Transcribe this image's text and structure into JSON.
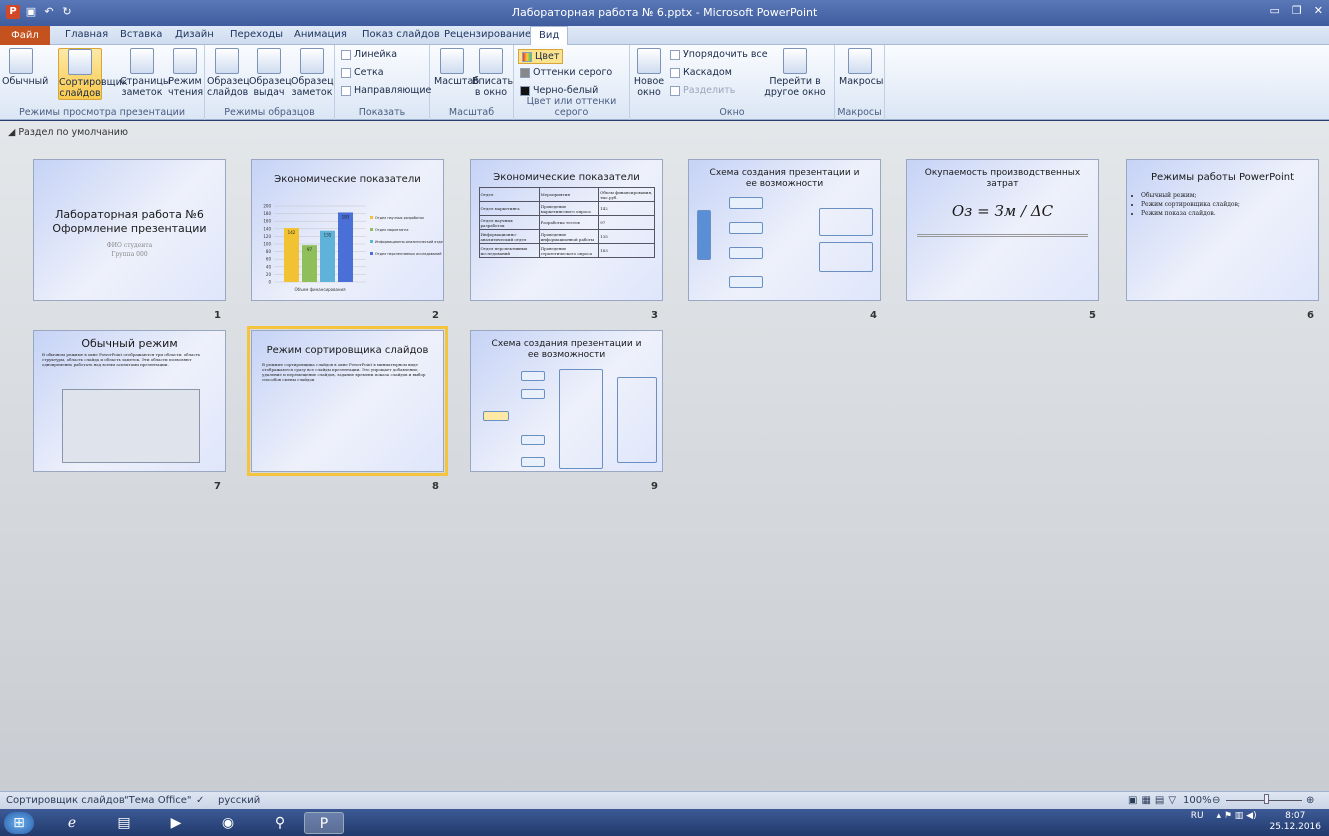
{
  "window": {
    "title": "Лабораторная работа № 6.pptx - Microsoft PowerPoint"
  },
  "tabs": [
    "Файл",
    "Главная",
    "Вставка",
    "Дизайн",
    "Переходы",
    "Анимация",
    "Показ слайдов",
    "Рецензирование",
    "Вид"
  ],
  "ribbon": {
    "groups": [
      {
        "label": "Режимы просмотра презентации",
        "buttons": [
          "Обычный",
          "Сортировщик слайдов",
          "Страницы заметок",
          "Режим чтения"
        ]
      },
      {
        "label": "Режимы образцов",
        "buttons": [
          "Образец слайдов",
          "Образец выдач",
          "Образец заметок"
        ]
      },
      {
        "label": "Показать",
        "items": [
          "Линейка",
          "Сетка",
          "Направляющие"
        ]
      },
      {
        "label": "Масштаб",
        "buttons": [
          "Масштаб",
          "Вписать в окно"
        ]
      },
      {
        "label": "Цвет или оттенки серого",
        "items": [
          "Цвет",
          "Оттенки серого",
          "Черно-белый"
        ]
      },
      {
        "label": "Окно",
        "buttons": [
          "Новое окно",
          "Перейти в другое окно"
        ],
        "items": [
          "Упорядочить все",
          "Каскадом",
          "Разделить"
        ]
      },
      {
        "label": "Макросы",
        "buttons": [
          "Макросы"
        ]
      }
    ]
  },
  "section": "Раздел по умолчанию",
  "slides": [
    {
      "n": "1",
      "title": "Лабораторная работа №6 Оформление презентации",
      "sub1": "ФИО студента",
      "sub2": "Группа 000"
    },
    {
      "n": "2",
      "title": "Экономические показатели",
      "chart_xlabel": "Объем финансирования",
      "legend": [
        "Отдел научных разработок",
        "Отдел маркетинга",
        "Информационно-аналитический отдел",
        "Отдел перспективных исследований"
      ]
    },
    {
      "n": "3",
      "title": "Экономические показатели",
      "headers": [
        "Отдел",
        "Мероприятия",
        "Объем финансирования, тыс.руб."
      ],
      "rows": [
        [
          "Отдел маркетинга",
          "Проведение маркетингового опроса",
          "142"
        ],
        [
          "Отдел научных разработок",
          "Разработка тестов",
          "97"
        ],
        [
          "Информационно-аналитический отдел",
          "Проведение информационной работы",
          "135"
        ],
        [
          "Отдел перспективных исследований",
          "Проведение стратегического опроса",
          "183"
        ]
      ]
    },
    {
      "n": "4",
      "title": "Схема создания презентации и ее возможности"
    },
    {
      "n": "5",
      "title": "Окупаемость производственных затрат",
      "formula": "Oз = Зм / ΔC"
    },
    {
      "n": "6",
      "title": "Режимы работы PowerPoint",
      "bullets": [
        "Обычный режим;",
        "Режим сортировщика слайдов;",
        "Режим показа слайдов."
      ]
    },
    {
      "n": "7",
      "title": "Обычный режим",
      "body": "В обычном режиме в окне PowerPoint отображаются три области: область структуры, область слайда и область заметок. Эти области позволяют одновременно работать над всеми аспектами презентации."
    },
    {
      "n": "8",
      "title": "Режим сортировщика слайдов",
      "body": "В режиме сортировщика слайдов в окне PowerPoint в миниатюрном виде отображаются сразу все слайды презентации. Это упрощает добавление, удаление и перемещение слайдов, задание времени показа слайдов и выбор способов смены слайдов."
    },
    {
      "n": "9",
      "title": "Схема создания презентации и ее возможности"
    }
  ],
  "chart_data": {
    "type": "bar",
    "categories": [
      "Объем финансирования"
    ],
    "series": [
      {
        "name": "Отдел научных разработок",
        "values": [
          142
        ]
      },
      {
        "name": "Отдел маркетинга",
        "values": [
          97
        ]
      },
      {
        "name": "Информационно-аналитический отдел",
        "values": [
          135
        ]
      },
      {
        "name": "Отдел перспективных исследований",
        "values": [
          183
        ]
      }
    ],
    "ylim": [
      0,
      200
    ],
    "colors": [
      "#f1c232",
      "#8fbf5a",
      "#5fb3d9",
      "#4a6fd6"
    ]
  },
  "status": {
    "view": "Сортировщик слайдов",
    "theme": "\"Тема Office\"",
    "lang": "русский",
    "zoom": "100%"
  },
  "tray": {
    "lang": "RU",
    "time": "8:07",
    "date": "25.12.2016"
  }
}
